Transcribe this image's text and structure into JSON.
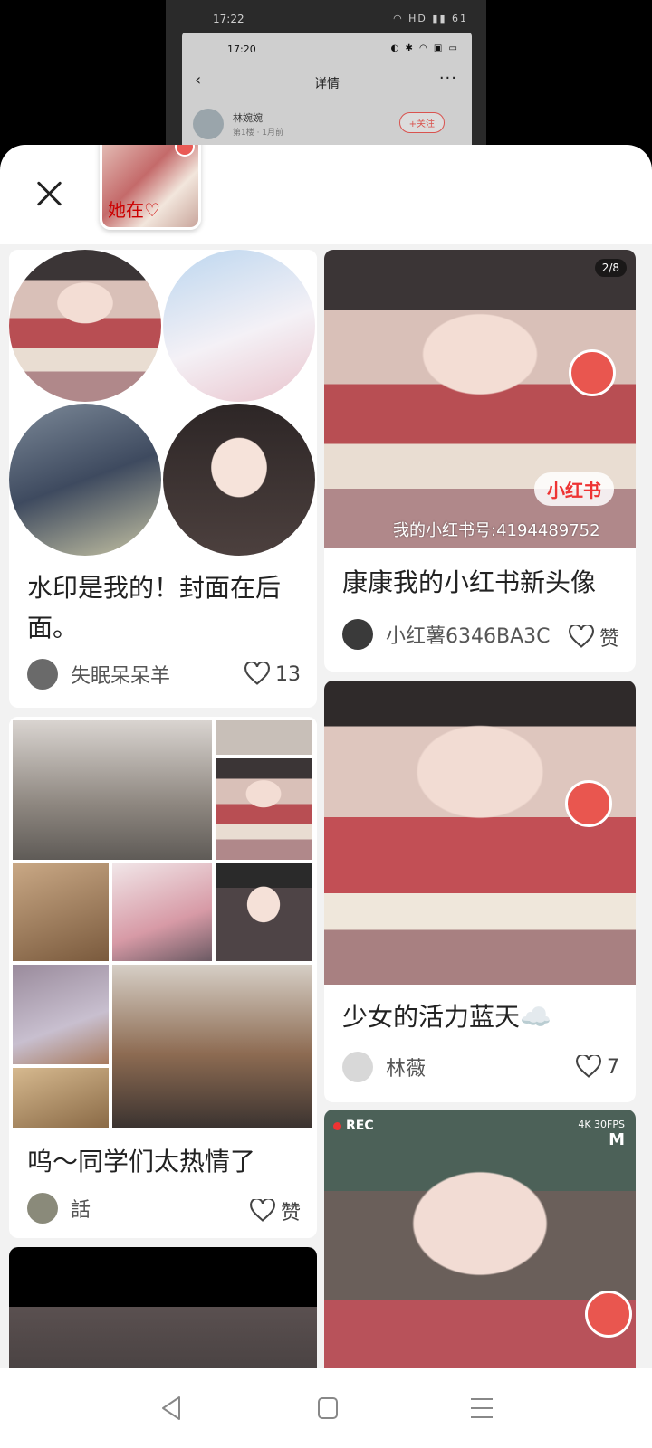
{
  "background": {
    "status_time": "17:22",
    "status_icons": "◠ HD ▮▮ 61",
    "inner_status_time": "17:20",
    "inner_status_icons": "◐ ✱ ◠ ▣ ▭",
    "title": "详情",
    "back": "‹",
    "more": "···",
    "author_name": "林婉婉",
    "author_meta": "第1楼 · 1月前",
    "follow": "+关注"
  },
  "sheet": {
    "close_label": "✕",
    "query_scribble": "她在♡"
  },
  "cards": [
    {
      "title": "水印是我的！封面在后面。",
      "author": "失眠呆呆羊",
      "likes": "13"
    },
    {
      "badge": "2/8",
      "watermark_pill": "小红书",
      "watermark_text": "我的小红书号:4194489752",
      "title": "康康我的小红书新头像",
      "author": "小红薯6346BA3C",
      "likes": "赞"
    },
    {
      "title": "呜～同学们太热情了",
      "author": "話",
      "likes": "赞"
    },
    {
      "title": "少女的活力蓝天☁️",
      "author": "林薇",
      "likes": "7"
    },
    {
      "rec": "REC",
      "hud_top": "4K 30FPS",
      "hud_letter": "M"
    }
  ],
  "colors": {
    "accent": "#ff2442",
    "feed_bg": "#f2f2f2",
    "text": "#222222"
  }
}
